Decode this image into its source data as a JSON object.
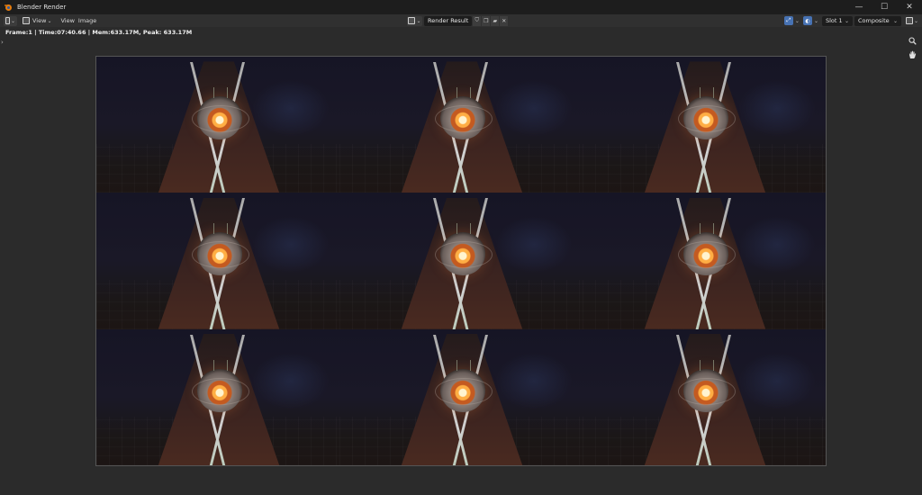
{
  "window": {
    "title": "Blender Render",
    "controls": {
      "minimize": "—",
      "maximize": "☐",
      "close": "✕"
    }
  },
  "header": {
    "menus": [
      "View",
      "Image"
    ],
    "mode_label": "View",
    "image_name": "Render Result",
    "slot_label": "Slot 1",
    "layer_label": "Composite"
  },
  "stats": {
    "text": "Frame:1 | Time:07:40.66 | Mem:633.17M, Peak: 633.17M"
  },
  "render": {
    "rows": 3,
    "cols": 3
  },
  "icons": {
    "app": "blender-logo-icon",
    "editor": "image-editor-icon",
    "zoom": "zoom-icon",
    "pan": "hand-icon"
  },
  "colors": {
    "accent": "#4772b3",
    "logo": "#e87d0d"
  }
}
